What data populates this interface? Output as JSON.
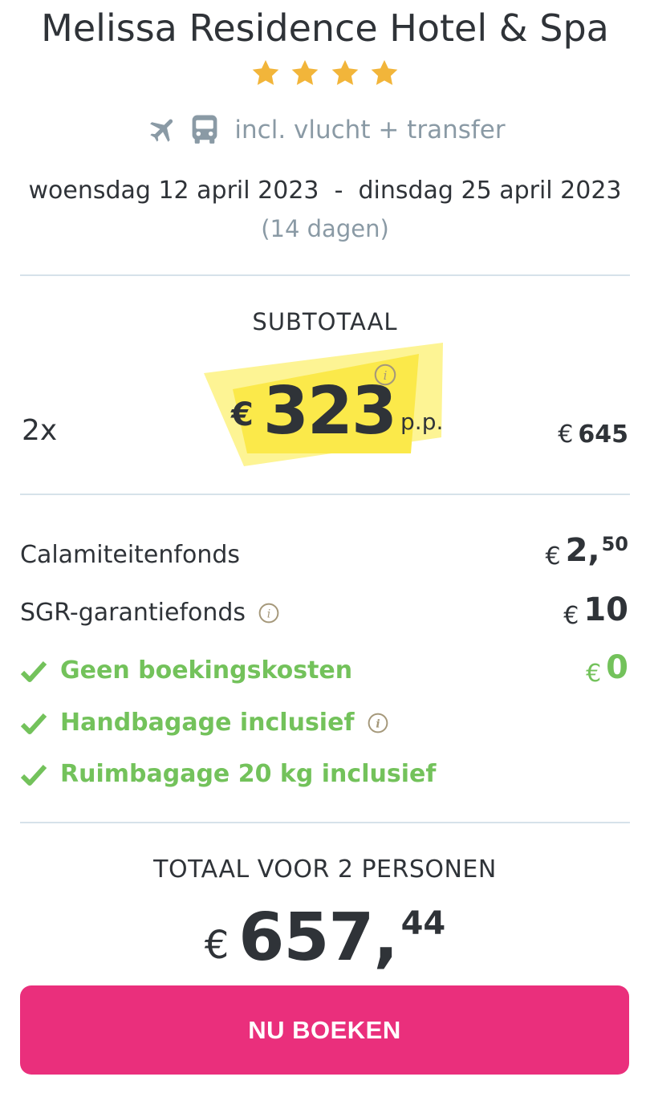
{
  "hotel": {
    "name": "Melissa Residence Hotel & Spa",
    "stars": 4,
    "includes_text": "incl. vlucht + transfer",
    "dates": "woensdag 12 april 2023  -  dinsdag 25 april 2023",
    "duration": "(14 dagen)"
  },
  "subtotal": {
    "label": "SUBTOTAAL",
    "quantity": "2x",
    "currency": "€",
    "price_pp": "323",
    "pp_suffix": "p.p.",
    "total_currency": "€",
    "total": "645"
  },
  "fees": {
    "calamity": {
      "label": "Calamiteitenfonds",
      "currency": "€",
      "amount": "2,",
      "cents": "50"
    },
    "sgr": {
      "label": "SGR-garantiefonds",
      "currency": "€",
      "amount": "10"
    }
  },
  "inclusions": {
    "booking": {
      "label": "Geen boekingskosten",
      "currency": "€",
      "amount": "0"
    },
    "hand_luggage": {
      "label": "Handbagage inclusief"
    },
    "hold_luggage": {
      "label": "Ruimbagage 20 kg inclusief"
    }
  },
  "total": {
    "label": "TOTAAL VOOR 2 PERSONEN",
    "currency": "€",
    "amount": "657,",
    "cents": "44"
  },
  "book_button": {
    "label": "NU BOEKEN"
  },
  "colors": {
    "accent": "#ea2f7c",
    "green": "#73c25b",
    "star": "#f2b53a",
    "highlight": "#fbe94a",
    "muted": "#8a9aa5"
  },
  "icons": [
    "star-icon",
    "plane-icon",
    "bus-icon",
    "info-icon",
    "check-icon"
  ]
}
